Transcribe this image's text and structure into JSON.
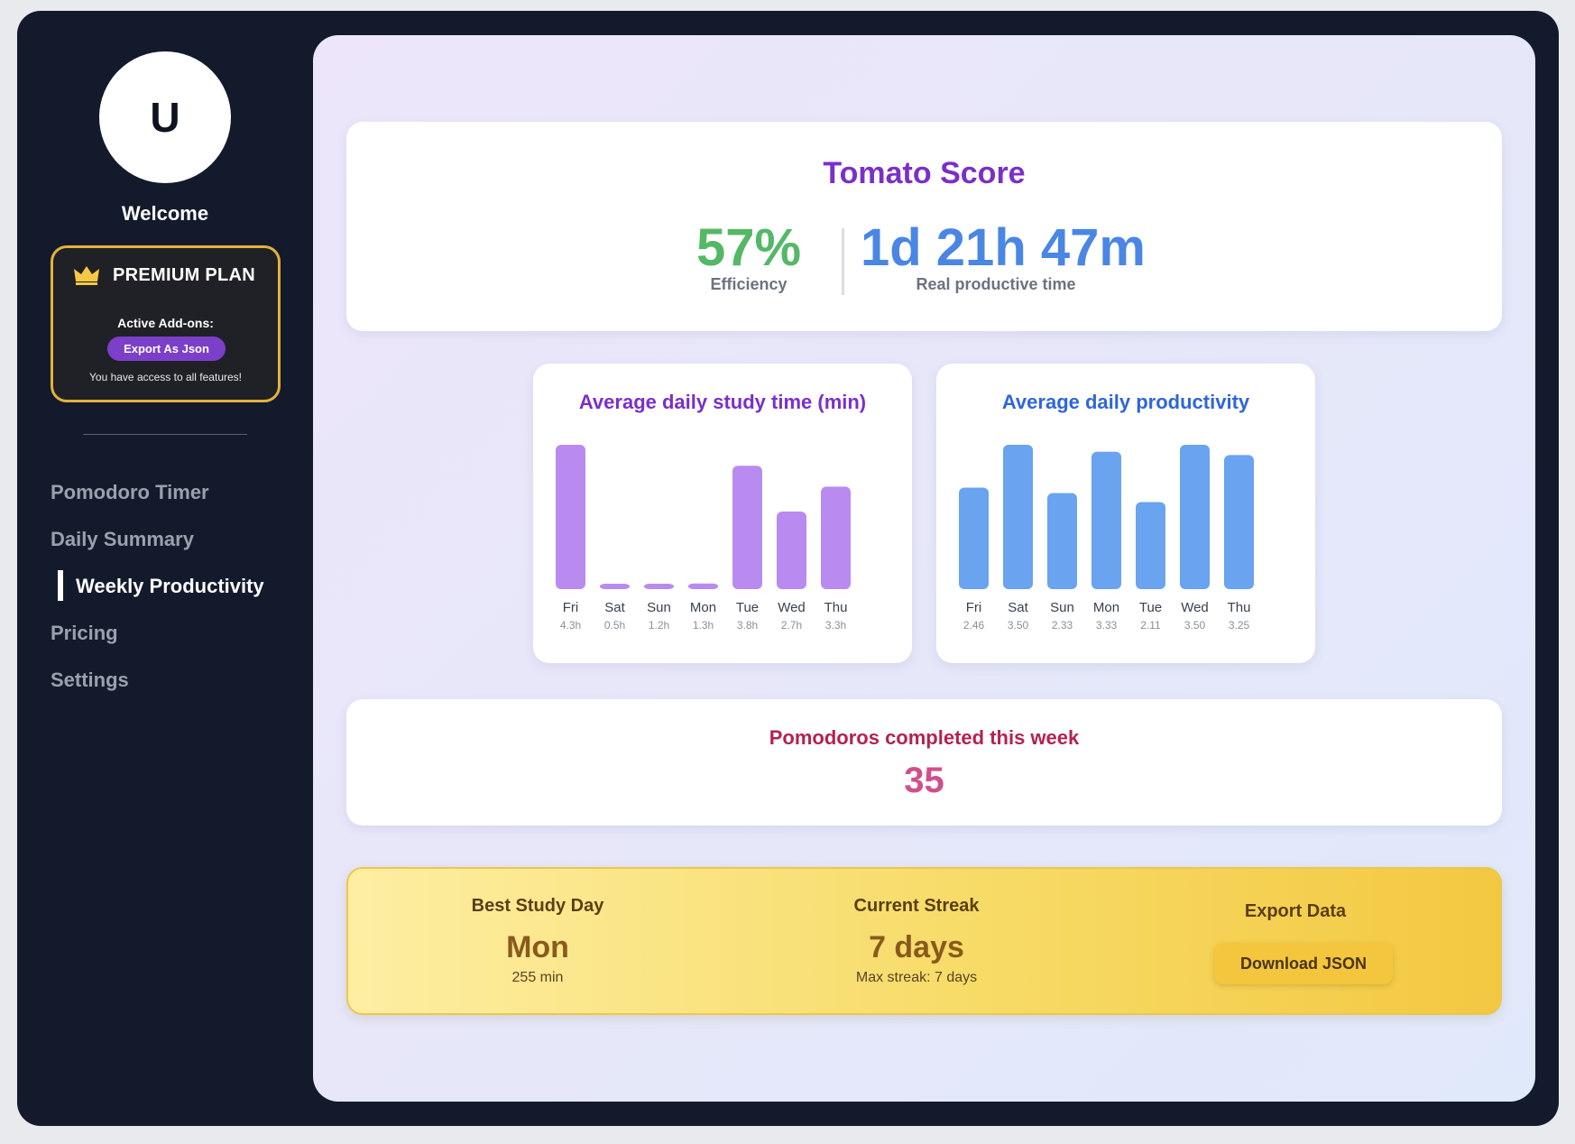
{
  "user": {
    "initial": "U",
    "welcome": "Welcome"
  },
  "plan": {
    "title": "PREMIUM PLAN",
    "addons_label": "Active Add-ons:",
    "addon": "Export As Json",
    "note": "You have access to all features!"
  },
  "nav": {
    "items": [
      {
        "label": "Pomodoro Timer",
        "active": false
      },
      {
        "label": "Daily Summary",
        "active": false
      },
      {
        "label": "Weekly Productivity",
        "active": true
      },
      {
        "label": "Pricing",
        "active": false
      },
      {
        "label": "Settings",
        "active": false
      }
    ]
  },
  "score": {
    "title": "Tomato Score",
    "efficiency_value": "57%",
    "efficiency_label": "Efficiency",
    "time_value": "1d 21h 47m",
    "time_label": "Real productive time"
  },
  "chart_data": [
    {
      "type": "bar",
      "title": "Average daily study time (min)",
      "categories": [
        "Fri",
        "Sat",
        "Sun",
        "Mon",
        "Tue",
        "Wed",
        "Thu"
      ],
      "values": [
        255,
        8,
        8,
        10,
        218,
        137,
        181
      ],
      "data_labels": [
        "4.3h",
        "0.5h",
        "1.2h",
        "1.3h",
        "3.8h",
        "2.7h",
        "3.3h"
      ],
      "color": "#b98bf1"
    },
    {
      "type": "bar",
      "title": "Average daily productivity",
      "categories": [
        "Fri",
        "Sat",
        "Sun",
        "Mon",
        "Tue",
        "Wed",
        "Thu"
      ],
      "values": [
        2.46,
        3.5,
        2.33,
        3.33,
        2.11,
        3.5,
        3.25
      ],
      "data_labels": [
        "2.46",
        "3.50",
        "2.33",
        "3.33",
        "2.11",
        "3.50",
        "3.25"
      ],
      "color": "#6aa3ef"
    }
  ],
  "pomodoros": {
    "title": "Pomodoros completed this week",
    "value": "35"
  },
  "stats": {
    "best_day_label": "Best Study Day",
    "best_day_value": "Mon",
    "best_day_sub": "255 min",
    "streak_label": "Current Streak",
    "streak_value": "7 days",
    "streak_sub": "Max streak: 7 days",
    "export_label": "Export Data",
    "export_button": "Download JSON"
  }
}
